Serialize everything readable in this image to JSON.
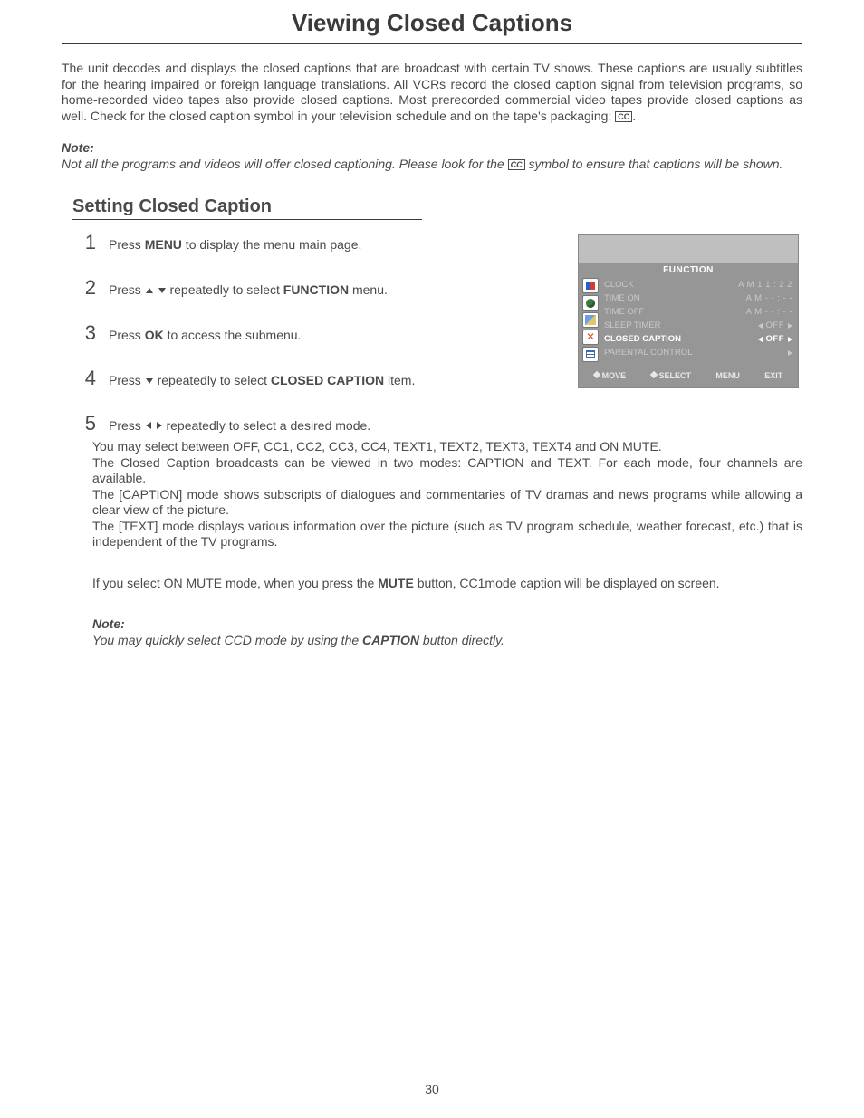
{
  "title": "Viewing Closed Captions",
  "intro": "The unit decodes and displays the closed captions that are broadcast with certain TV shows. These captions are usually subtitles for the hearing impaired or foreign language translations. All VCRs record the closed caption signal from television programs, so home-recorded video tapes also provide closed captions. Most prerecorded commercial video tapes provide closed captions as well. Check for the closed caption symbol in your television schedule and on the tape's packaging:",
  "cc_symbol": "CC",
  "note1": {
    "label": "Note:",
    "text_a": "Not all the programs and videos will offer closed captioning. Please look for the ",
    "text_b": " symbol to ensure that captions will be shown."
  },
  "section": "Setting Closed Caption",
  "steps": {
    "s1": {
      "num": "1",
      "a": "Press  ",
      "b": "MENU",
      "c": " to display the menu main page."
    },
    "s2": {
      "num": "2",
      "a": "Press  ",
      "c": "  repeatedly to select ",
      "d": "FUNCTION",
      "e": " menu."
    },
    "s3": {
      "num": "3",
      "a": "Press ",
      "b": "OK",
      "c": " to access the submenu."
    },
    "s4": {
      "num": "4",
      "a": "Press  ",
      "c": "  repeatedly to select ",
      "d": "CLOSED CAPTION",
      "e": " item."
    },
    "s5": {
      "num": "5",
      "a": "Press  ",
      "c": " repeatedly to select a desired mode."
    }
  },
  "body": {
    "p1": "You may select between OFF, CC1, CC2, CC3, CC4, TEXT1, TEXT2, TEXT3, TEXT4 and ON MUTE.",
    "p2": "The Closed Caption broadcasts can be viewed in two modes: CAPTION and TEXT. For each mode, four channels are available.",
    "p3": "The [CAPTION] mode shows subscripts of dialogues and commentaries of TV dramas and news programs while allowing a clear view of the picture.",
    "p4": "The [TEXT] mode displays various information over the picture (such as TV program schedule, weather forecast, etc.) that is independent of the TV programs.",
    "p5a": "If you select ON MUTE mode, when you press the ",
    "p5b": "MUTE",
    "p5c": "  button, CC1mode caption will be displayed on screen."
  },
  "note2": {
    "label": "Note:",
    "a": "You may quickly select CCD mode by using the ",
    "b": "CAPTION",
    "c": " button directly."
  },
  "page_number": "30",
  "osd": {
    "title": "FUNCTION",
    "rows": [
      {
        "label": "CLOCK",
        "value": "A M 1 1 : 2 2",
        "arrows": false
      },
      {
        "label": "TIME ON",
        "value": "A M - - : - -",
        "arrows": false
      },
      {
        "label": "TIME OFF",
        "value": "A M - - : - -",
        "arrows": false
      },
      {
        "label": "SLEEP TIMER",
        "value": "OFF",
        "arrows": true
      },
      {
        "label": "CLOSED CAPTION",
        "value": "OFF",
        "arrows": true,
        "active": true
      },
      {
        "label": "PARENTAL CONTROL",
        "value": "",
        "arrows": "right"
      }
    ],
    "foot": {
      "move": "MOVE",
      "select": "SELECT",
      "menu": "MENU",
      "exit": "EXIT"
    }
  }
}
